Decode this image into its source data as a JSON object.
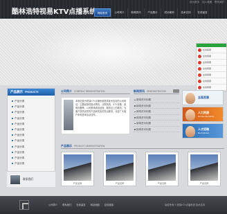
{
  "header": {
    "logo": "酷林浩特视易KTV点播系统",
    "top_links": [
      "设为首页",
      "加入收藏",
      "联系我们"
    ]
  },
  "nav": {
    "items": [
      {
        "label": "网站首页",
        "active": true
      },
      {
        "label": "公司简介",
        "active": false
      },
      {
        "label": "新闻资讯",
        "active": false
      },
      {
        "label": "产品展示",
        "active": false
      },
      {
        "label": "成功案例",
        "active": false
      },
      {
        "label": "技术支持",
        "active": false
      },
      {
        "label": "在线留言",
        "active": false
      }
    ]
  },
  "float_panel": {
    "items": [
      "在线客服",
      "在线客服",
      "在线客服",
      "在线客服",
      "在线客服",
      "在线客服",
      "在线客服"
    ]
  },
  "products": {
    "title_zh": "产品展示",
    "title_en": "PRODUCTS",
    "items": [
      "产品分类",
      "产品分类",
      "产品分类",
      "产品分类",
      "产品分类",
      "产品分类",
      "产品分类",
      "产品分类",
      "产品分类",
      "产品分类",
      "产品分类",
      "产品分类"
    ],
    "thumb_label": "联系我们"
  },
  "company": {
    "title_zh": "公司简介",
    "title_en": "COMPANY DEMONSTRATION",
    "text": "本网站是为视易KTV点播系统提供技术支持的公司网站，主要经营视易点歌机、点歌系统、KTV设备、音响设备等。公司秉承诚信经营、服务至上的理念，为客户提供优质的产品和完善的售后服务。欢迎广大客户来电咨询洽谈合作。"
  },
  "news": {
    "title_zh": "新闻资讯",
    "title_en": "DEMONSTRATION",
    "items": [
      "新闻资讯标题",
      "新闻资讯标题",
      "新闻资讯标题",
      "新闻资讯标题",
      "新闻资讯标题",
      "新闻资讯标题"
    ]
  },
  "ads": {
    "items": [
      {
        "title": "全面发展",
        "sub": ""
      },
      {
        "title": "人力资源",
        "sub": "Human Resource"
      },
      {
        "title": "人才招聘",
        "sub": "Recruitment"
      }
    ]
  },
  "cases": {
    "title_zh": "产品展示",
    "title_en": "PRODUCT DEMONSTRATION",
    "items": [
      {
        "caption": "产品名称"
      },
      {
        "caption": "产品名称"
      },
      {
        "caption": "产品名称"
      },
      {
        "caption": "产品名称"
      }
    ]
  },
  "footer": {
    "links": [
      "公司简介",
      "联系我们",
      "在线留言",
      "网站地图",
      "友情链接"
    ],
    "copyright": "版权所有 © 视易KTV点播系统 技术支持"
  },
  "colors": {
    "nav_active": "#2a62ad",
    "header_bg": "#25282d",
    "accent_blue": "#1e57a5"
  }
}
